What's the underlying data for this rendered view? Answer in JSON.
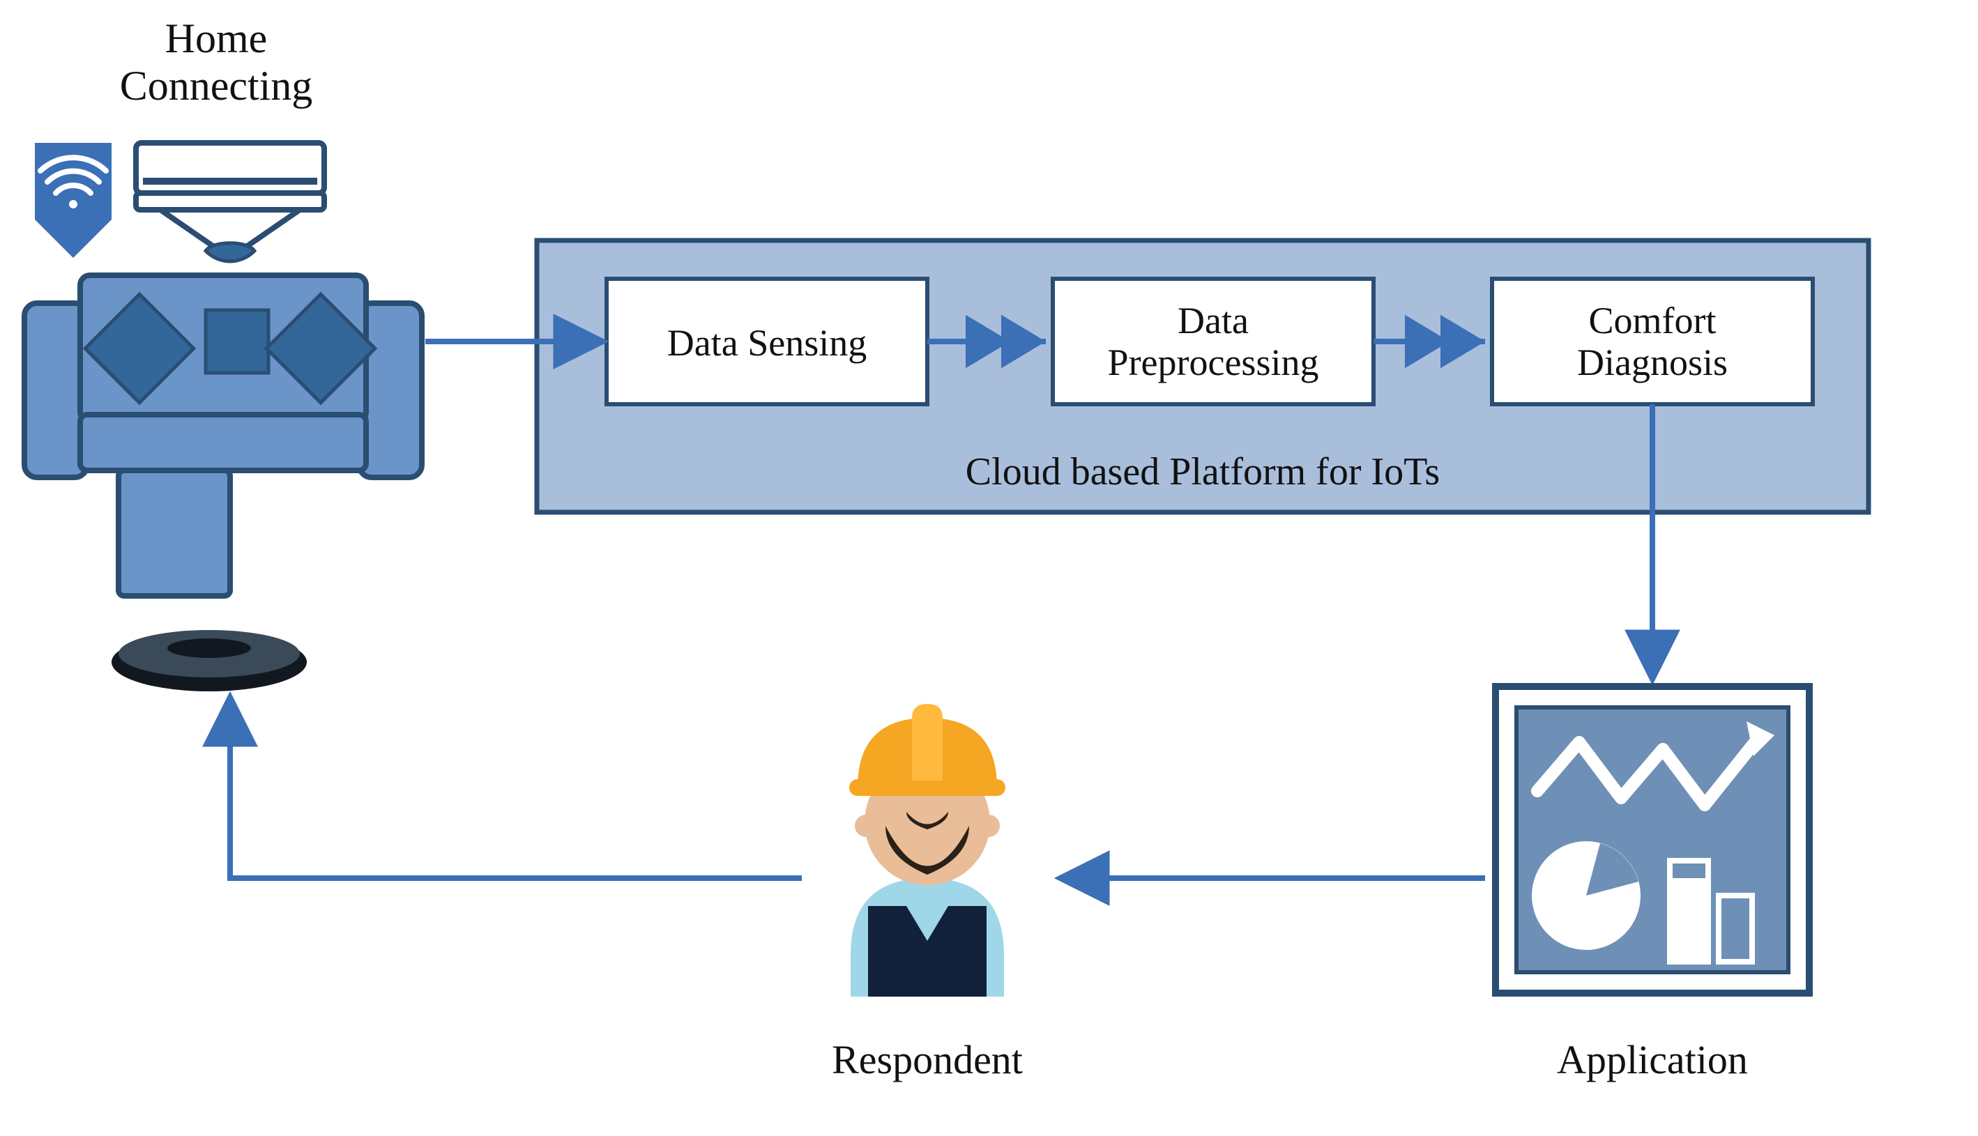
{
  "labels": {
    "home_title": "Home\nConnecting",
    "platform_title": "Cloud based Platform for IoTs",
    "box1": "Data Sensing",
    "box2": "Data\nPreprocessing",
    "box3": "Comfort\nDiagnosis",
    "respondent": "Respondent",
    "application": "Application"
  },
  "colors": {
    "arrow": "#3b6fb6",
    "panel_fill": "#a9bedb",
    "panel_stroke": "#2a4d72",
    "box_stroke": "#2a4d72",
    "box_fill": "#ffffff",
    "app_inner": "#6e90b6",
    "app_outer": "#2a4d72",
    "sofa": "#6b94c9",
    "sofa_dark": "#336699",
    "wifi_bg": "#3b6fb6",
    "text": "#111111"
  },
  "icons": {
    "wifi": "wifi-icon",
    "ac": "air-conditioner-icon",
    "sofa": "sofa-icon",
    "robot": "robot-vacuum-icon",
    "worker": "worker-person-icon",
    "dashboard": "analytics-dashboard-icon"
  },
  "flow": [
    "Home Connecting",
    "Data Sensing",
    "Data Preprocessing",
    "Comfort Diagnosis",
    "Application",
    "Respondent",
    "Home Connecting"
  ]
}
